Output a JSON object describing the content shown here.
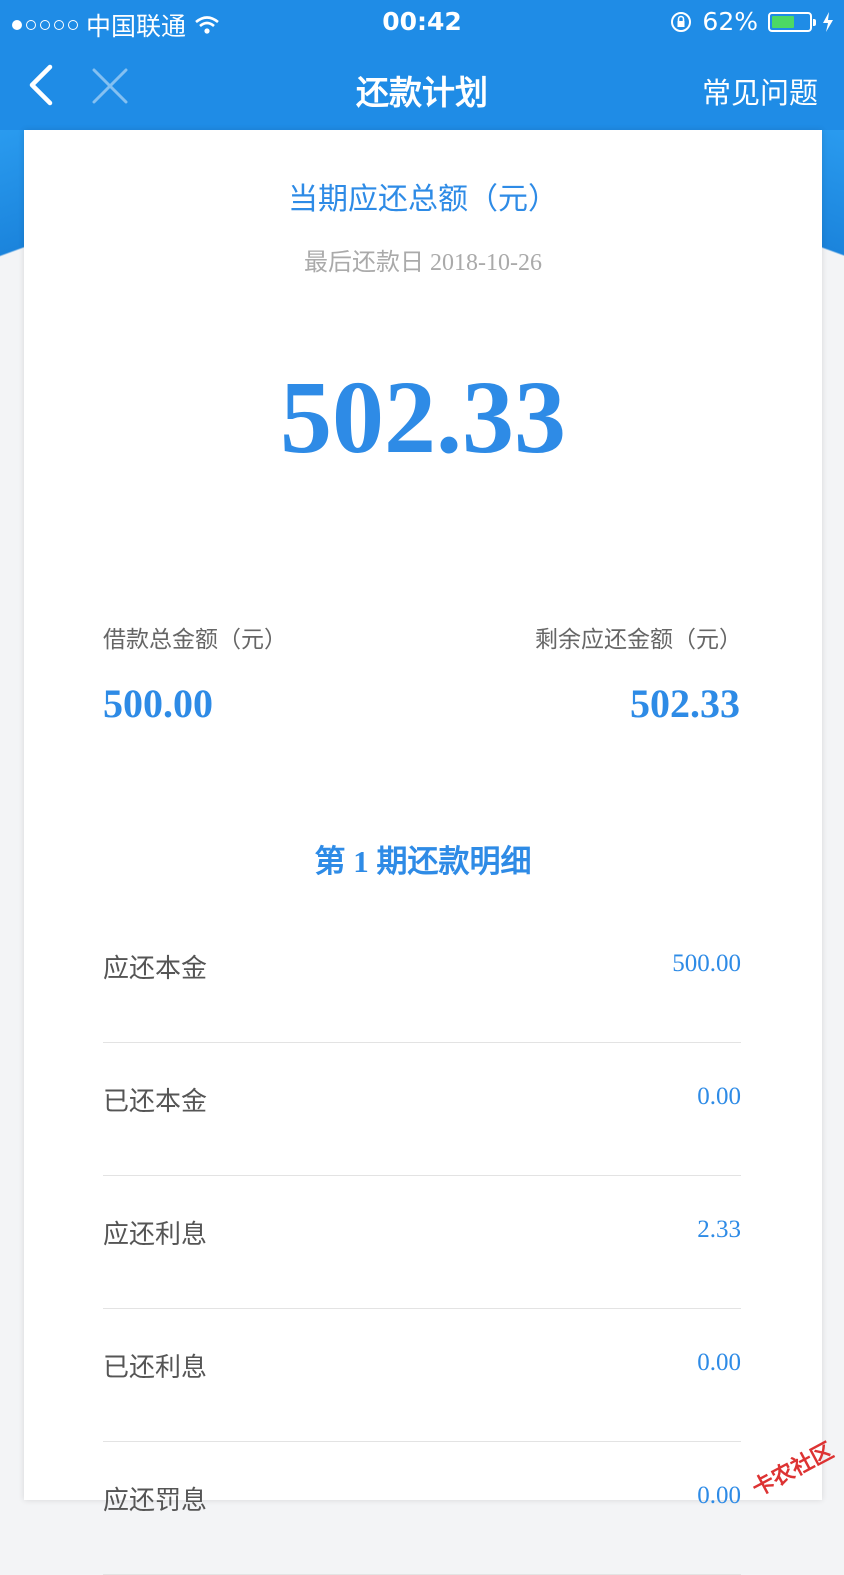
{
  "status_bar": {
    "carrier": "中国联通",
    "time": "00:42",
    "battery_percent_text": "62%",
    "battery_level": 0.62
  },
  "nav": {
    "title": "还款计划",
    "faq_label": "常见问题"
  },
  "summary": {
    "due_title": "当期应还总额（元）",
    "due_date": "最后还款日 2018-10-26",
    "due_amount": "502.33",
    "loan_total_label": "借款总金额（元）",
    "loan_total_value": "500.00",
    "remaining_label": "剩余应还金额（元）",
    "remaining_value": "502.33"
  },
  "detail": {
    "title": "第 1 期还款明细",
    "rows": [
      {
        "label": "应还本金",
        "value": "500.00"
      },
      {
        "label": "已还本金",
        "value": "0.00"
      },
      {
        "label": "应还利息",
        "value": "2.33"
      },
      {
        "label": "已还利息",
        "value": "0.00"
      },
      {
        "label": "应还罚息",
        "value": "0.00"
      }
    ]
  },
  "watermark": "卡农社区",
  "colors": {
    "brand_blue": "#1f8ce6",
    "amount_blue": "#2e8be6"
  }
}
